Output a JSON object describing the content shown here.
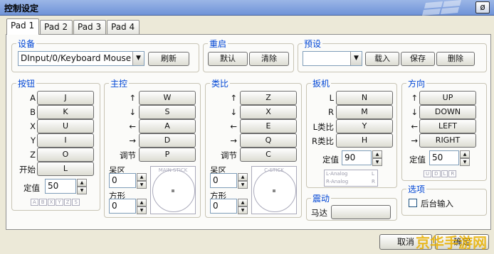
{
  "window": {
    "title": "控制设定",
    "close_glyph": "ø"
  },
  "tabs": [
    "Pad 1",
    "Pad 2",
    "Pad 3",
    "Pad 4"
  ],
  "device": {
    "title": "设备",
    "value": "DInput/0/Keyboard Mouse",
    "refresh": "刷新"
  },
  "restart": {
    "title": "重启",
    "default": "默认",
    "clear": "清除"
  },
  "preset": {
    "title": "预设",
    "value": "",
    "load": "载入",
    "save": "保存",
    "delete": "删除"
  },
  "buttons": {
    "title": "按钮",
    "rows": [
      {
        "label": "A",
        "key": "J"
      },
      {
        "label": "B",
        "key": "K"
      },
      {
        "label": "X",
        "key": "U"
      },
      {
        "label": "Y",
        "key": "I"
      },
      {
        "label": "Z",
        "key": "O"
      },
      {
        "label": "开始",
        "key": "L"
      }
    ],
    "threshold_label": "定值",
    "threshold": "50",
    "chips": [
      "A",
      "B",
      "X",
      "Y",
      "Z",
      "S"
    ]
  },
  "main": {
    "title": "主控",
    "rows": [
      {
        "label": "↑",
        "key": "W"
      },
      {
        "label": "↓",
        "key": "S"
      },
      {
        "label": "←",
        "key": "A"
      },
      {
        "label": "→",
        "key": "D"
      },
      {
        "label": "调节",
        "key": "P"
      }
    ],
    "dead_label": "呆区",
    "dead": "0",
    "square_label": "方形",
    "square": "0",
    "stick_label": "MAIN STICK"
  },
  "cstick": {
    "title": "类比",
    "rows": [
      {
        "label": "↑",
        "key": "Z"
      },
      {
        "label": "↓",
        "key": "X"
      },
      {
        "label": "←",
        "key": "E"
      },
      {
        "label": "→",
        "key": "Q"
      },
      {
        "label": "调节",
        "key": "C"
      }
    ],
    "dead_label": "呆区",
    "dead": "0",
    "square_label": "方形",
    "square": "0",
    "stick_label": "C-STICK"
  },
  "triggers": {
    "title": "扳机",
    "rows": [
      {
        "label": "L",
        "key": "N"
      },
      {
        "label": "R",
        "key": "M"
      },
      {
        "label": "L类比",
        "key": "Y"
      },
      {
        "label": "R类比",
        "key": "H"
      }
    ],
    "threshold_label": "定值",
    "threshold": "90",
    "analog": [
      "L-Analog",
      "L",
      "R-Analog",
      "R"
    ]
  },
  "rumble": {
    "title": "震动",
    "motor_label": "马达",
    "motor": ""
  },
  "dpad": {
    "title": "方向",
    "rows": [
      {
        "label": "↑",
        "key": "UP"
      },
      {
        "label": "↓",
        "key": "DOWN"
      },
      {
        "label": "←",
        "key": "LEFT"
      },
      {
        "label": "→",
        "key": "RIGHT"
      }
    ],
    "threshold_label": "定值",
    "threshold": "50",
    "chips": [
      "U",
      "D",
      "L",
      "R"
    ]
  },
  "options": {
    "title": "选项",
    "background_input": "后台输入"
  },
  "footer": {
    "cancel": "取消",
    "ok": "确定"
  },
  "watermark": "京华手游网"
}
